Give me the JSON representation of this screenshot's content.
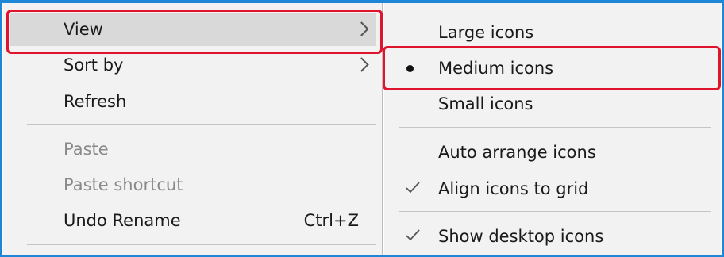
{
  "context_menu": {
    "items": [
      {
        "label": "View",
        "submenu": true,
        "highlighted": true
      },
      {
        "label": "Sort by",
        "submenu": true
      },
      {
        "label": "Refresh"
      },
      {
        "label": "Paste",
        "disabled": true
      },
      {
        "label": "Paste shortcut",
        "disabled": true
      },
      {
        "label": "Undo Rename",
        "shortcut": "Ctrl+Z"
      }
    ]
  },
  "view_submenu": {
    "items": [
      {
        "label": "Large icons"
      },
      {
        "label": "Medium icons",
        "selected": true,
        "mark": "bullet-icon"
      },
      {
        "label": "Small icons"
      },
      {
        "label": "Auto arrange icons"
      },
      {
        "label": "Align icons to grid",
        "checked": true,
        "mark": "checkmark-icon"
      },
      {
        "label": "Show desktop icons",
        "checked": true,
        "mark": "checkmark-icon"
      }
    ]
  },
  "colors": {
    "annotation": "#e0142d",
    "screenshot_border": "#1e86d6",
    "menu_background": "#f2f2f2",
    "hover_background": "#d9d9d9",
    "disabled_text": "#8a8a8a"
  }
}
